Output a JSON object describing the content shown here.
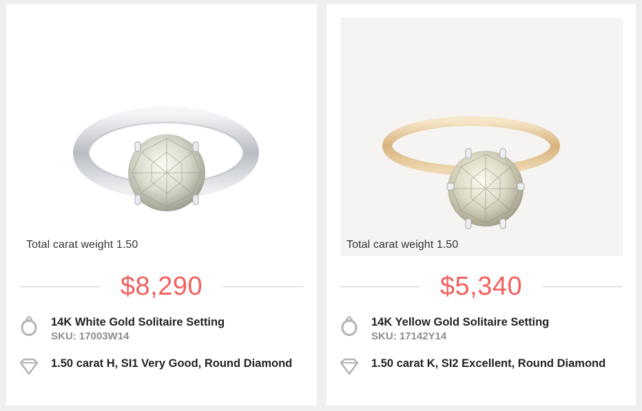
{
  "products": [
    {
      "caption": "Total carat weight 1.50",
      "price": "$8,290",
      "setting": {
        "name": "14K White Gold Solitaire Setting",
        "sku": "SKU: 17003W14"
      },
      "diamond": "1.50 carat H, SI1 Very Good, Round Diamond",
      "metal_color": "#c9ccd2"
    },
    {
      "caption": "Total carat weight 1.50",
      "price": "$5,340",
      "setting": {
        "name": "14K Yellow Gold Solitaire Setting",
        "sku": "SKU: 17142Y14"
      },
      "diamond": "1.50 carat K, SI2 Excellent, Round Diamond",
      "metal_color": "#e6c89a"
    }
  ],
  "icons": {
    "setting": "ring-icon",
    "diamond": "diamond-icon"
  },
  "colors": {
    "price": "#f2605d",
    "icon": "#b3b3b3",
    "sku": "#8c8c8c"
  }
}
